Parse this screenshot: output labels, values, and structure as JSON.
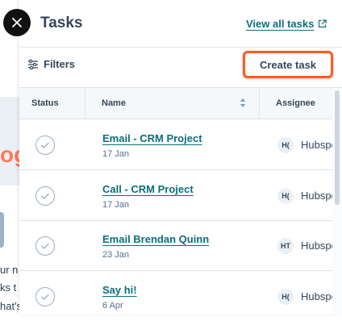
{
  "background": {
    "big_text": "og",
    "lines": [
      "ur n",
      "ks t",
      "hat's"
    ]
  },
  "panel": {
    "title": "Tasks",
    "view_all_label": "View all tasks",
    "filters_label": "Filters",
    "create_task_label": "Create task"
  },
  "table": {
    "columns": [
      "Status",
      "Name",
      "Assignee"
    ],
    "rows": [
      {
        "name": "Email - CRM Project",
        "date": "17 Jan",
        "avatar": "H(",
        "assignee": "Hubspot"
      },
      {
        "name": "Call - CRM Project",
        "date": "17 Jan",
        "avatar": "H(",
        "assignee": "Hubspot"
      },
      {
        "name": "Email Brendan Quinn",
        "date": "23 Jan",
        "avatar": "HT",
        "assignee": "Hubspot"
      },
      {
        "name": "Say hi!",
        "date": "6 Apr",
        "avatar": "H(",
        "assignee": "Hubspot"
      }
    ]
  },
  "colors": {
    "link": "#0b6e7a",
    "highlight": "#ff5a1f",
    "text": "#33475b"
  },
  "icons": [
    "close-icon",
    "external-link-icon",
    "filter-sliders-icon",
    "sort-icon",
    "checkmark-icon"
  ]
}
